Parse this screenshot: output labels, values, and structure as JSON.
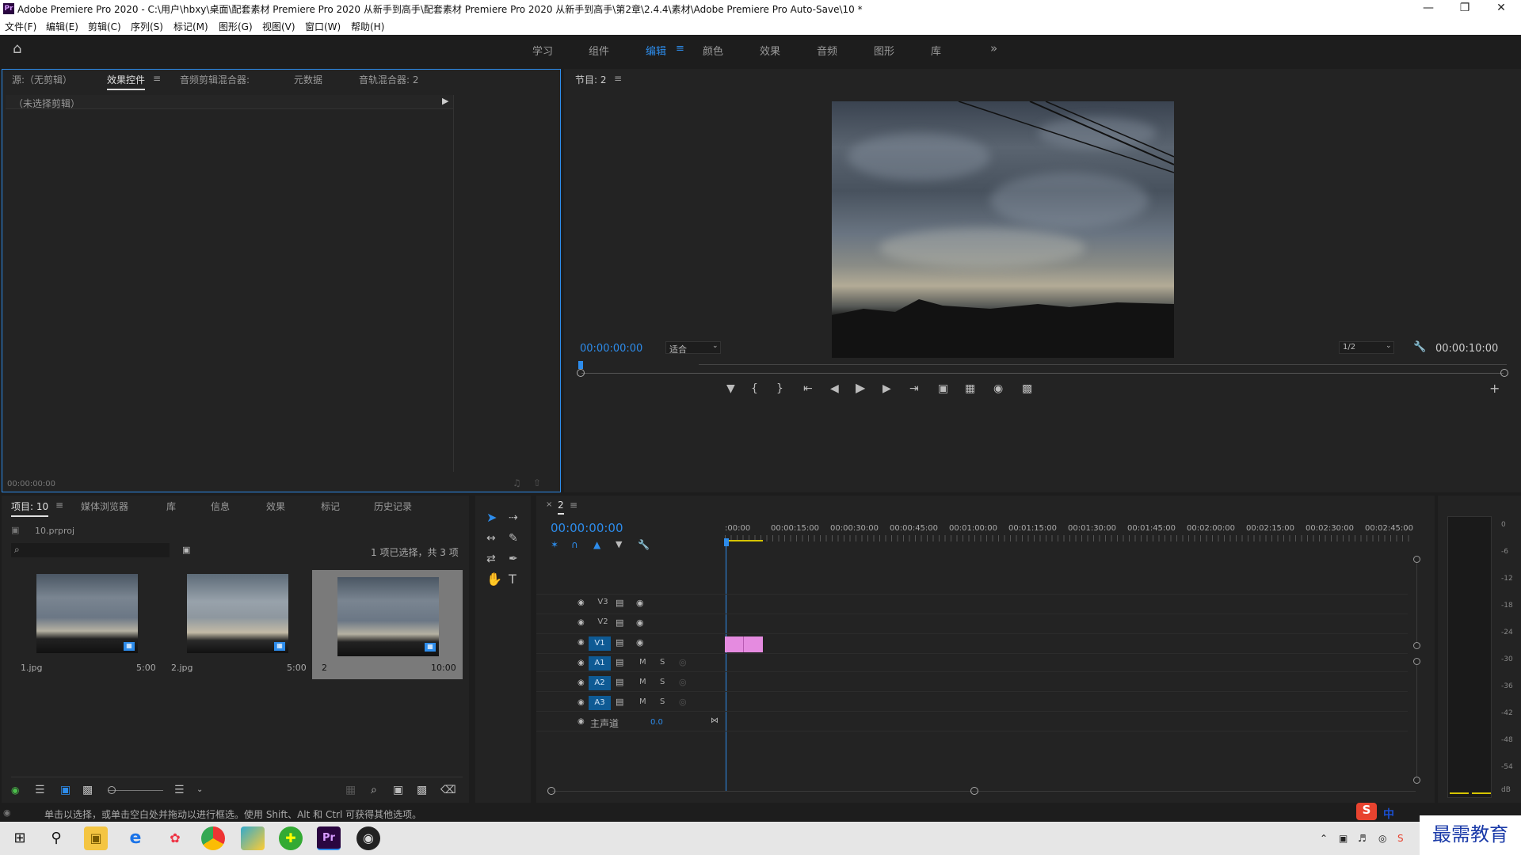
{
  "window": {
    "title": "Adobe Premiere Pro 2020 - C:\\用户\\hbxy\\桌面\\配套素材 Premiere Pro 2020 从新手到高手\\配套素材 Premiere Pro 2020 从新手到高手\\第2章\\2.4.4\\素材\\Adobe Premiere Pro Auto-Save\\10 *",
    "logo": "Pr"
  },
  "menu": [
    "文件(F)",
    "编辑(E)",
    "剪辑(C)",
    "序列(S)",
    "标记(M)",
    "图形(G)",
    "视图(V)",
    "窗口(W)",
    "帮助(H)"
  ],
  "workspaces": {
    "items": [
      "学习",
      "组件",
      "编辑",
      "颜色",
      "效果",
      "音频",
      "图形",
      "库"
    ],
    "active": "编辑",
    "more": "»"
  },
  "source_panel": {
    "tabs": [
      "源:（无剪辑）",
      "效果控件",
      "音频剪辑混合器:",
      "元数据",
      "音轨混合器: 2"
    ],
    "active_tab": "效果控件",
    "no_clip": "（未选择剪辑）",
    "timecode": "00:00:00:00"
  },
  "program_monitor": {
    "title": "节目: 2",
    "timecode_left": "00:00:00:00",
    "fit": "适合",
    "resolution": "1/2",
    "timecode_right": "00:00:10:00"
  },
  "project_panel": {
    "tabs": [
      "项目: 10",
      "媒体浏览器",
      "库",
      "信息",
      "效果",
      "标记",
      "历史记录"
    ],
    "active_tab": "项目: 10",
    "file": "10.prproj",
    "selection": "1 项已选择，共 3 项",
    "items": [
      {
        "name": "1.jpg",
        "duration": "5:00"
      },
      {
        "name": "2.jpg",
        "duration": "5:00"
      },
      {
        "name": "2",
        "duration": "10:00"
      }
    ]
  },
  "timeline": {
    "sequence": "2",
    "timecode": "00:00:00:00",
    "ruler": [
      ":00:00",
      "00:00:15:00",
      "00:00:30:00",
      "00:00:45:00",
      "00:01:00:00",
      "00:01:15:00",
      "00:01:30:00",
      "00:01:45:00",
      "00:02:00:00",
      "00:02:15:00",
      "00:02:30:00",
      "00:02:45:00"
    ],
    "video_tracks": [
      "V3",
      "V2",
      "V1"
    ],
    "audio_tracks": [
      "A1",
      "A2",
      "A3"
    ],
    "mute": "M",
    "solo": "S",
    "master": "主声道",
    "master_value": "0.0"
  },
  "meter": {
    "scale": [
      "0",
      "-6",
      "-12",
      "-18",
      "-24",
      "-30",
      "-36",
      "-42",
      "-48",
      "-54",
      "dB"
    ]
  },
  "status": {
    "text": "单击以选择，或单击空白处并拖动以进行框选。使用 Shift、Alt 和 Ctrl 可获得其他选项。"
  },
  "tray": {
    "ime": "中",
    "watermark": "最需教育"
  },
  "colors": {
    "accent": "#2d8ceb",
    "clip": "#e58be0",
    "track_active": "#0e5a94"
  }
}
